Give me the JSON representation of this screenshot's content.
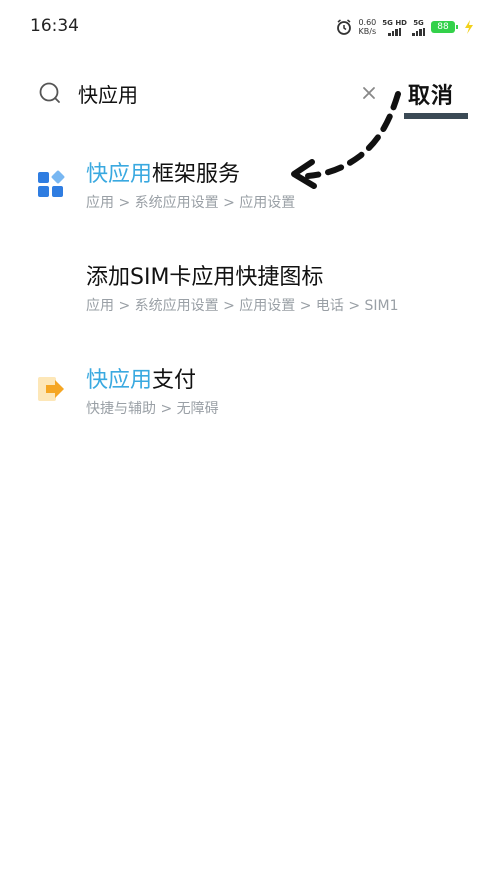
{
  "status_bar": {
    "time": "16:34",
    "speed_value": "0.60",
    "speed_unit": "KB/s",
    "net1": "5G HD",
    "net2": "5G",
    "battery": "88"
  },
  "search": {
    "query": "快应用",
    "cancel_label": "取消"
  },
  "results": [
    {
      "highlight": "快应用",
      "rest": "框架服务",
      "path": "应用 > 系统应用设置 > 应用设置",
      "icon": "apps-grid-icon"
    },
    {
      "highlight": "",
      "rest": "添加SIM卡应用快捷图标",
      "path": "应用 > 系统应用设置 > 应用设置 > 电话 > SIM1",
      "icon": ""
    },
    {
      "highlight": "快应用",
      "rest": "支付",
      "path": "快捷与辅助 > 无障碍",
      "icon": "shortcut-arrow-icon"
    }
  ],
  "colors": {
    "highlight": "#3aa9e0",
    "path_gray": "#9aa0a6",
    "apps_icon_blue": "#2f7de1",
    "shortcut_icon_orange": "#f5a623",
    "battery_green": "#33d14a"
  }
}
